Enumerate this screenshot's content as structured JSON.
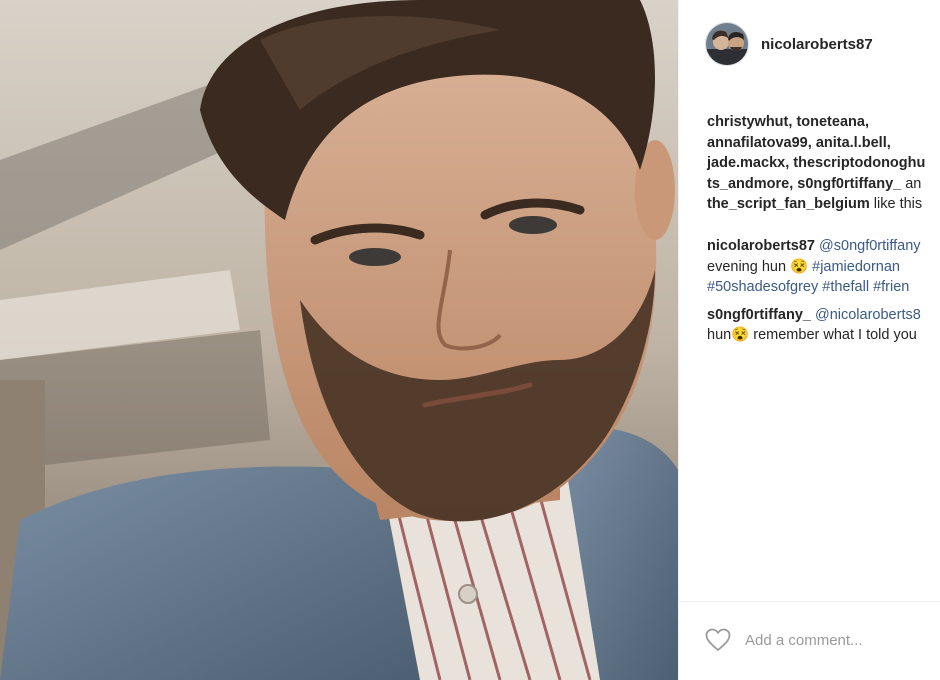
{
  "post": {
    "username": "nicolaroberts87",
    "avatar_alt": "user-avatar"
  },
  "likes": {
    "names": [
      "christywhut",
      "toneteana",
      "annafilatova99",
      "anita.l.bell",
      "jade.mackx",
      "thescriptodonoghu",
      "ts_andmore",
      "s0ngf0rtiffany_",
      "the_script_fan_belgium"
    ],
    "sep1": ", ",
    "conj": " an",
    "suffix": " like this"
  },
  "comments": [
    {
      "author": "nicolaroberts87",
      "mention": "@s0ngf0rtiffany",
      "text_line2": "evening hun 😵 ",
      "tags_line2": [
        "#jamiedornan"
      ],
      "tags_line3": [
        "#50shadesofgrey",
        "#thefall",
        "#frien"
      ]
    },
    {
      "author": "s0ngf0rtiffany_",
      "mention": "@nicolaroberts8",
      "text_line2": "hun😵 remember what I told you"
    }
  ],
  "footer": {
    "comment_placeholder": "Add a comment...",
    "like_icon": "heart-outline-icon"
  },
  "colors": {
    "link": "#3b5a85",
    "text": "#262626",
    "placeholder": "#9a9a9a",
    "divider": "#efefef"
  }
}
